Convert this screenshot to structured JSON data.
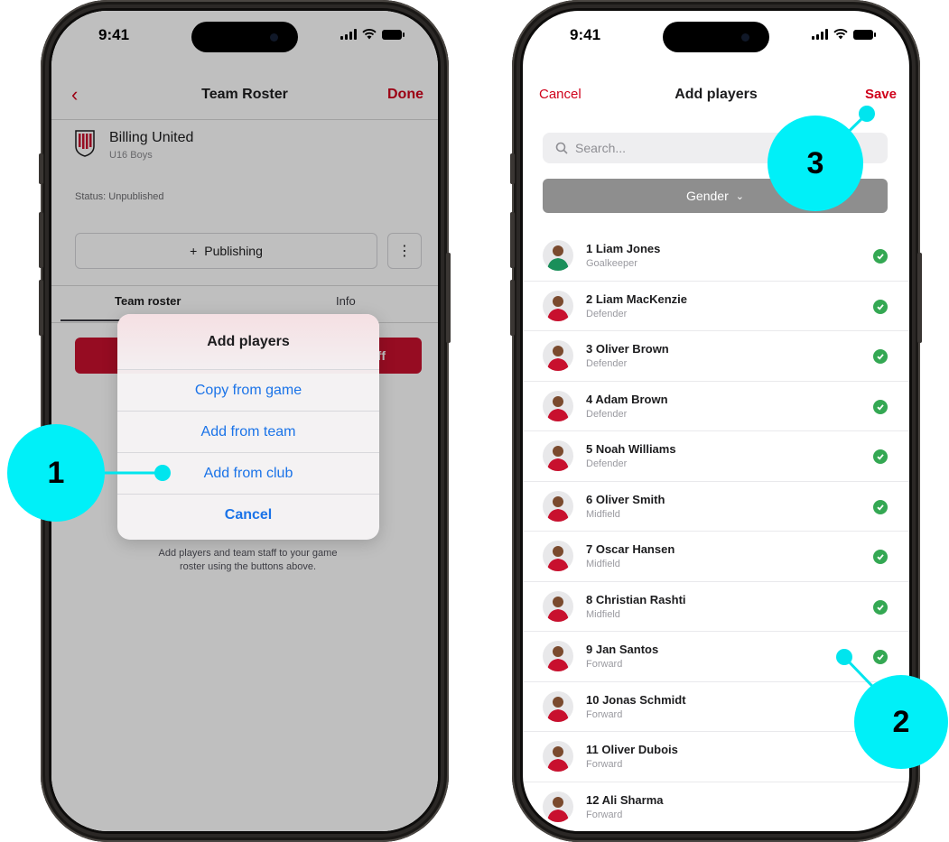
{
  "left_screen": {
    "time": "9:41",
    "nav": {
      "title": "Team Roster",
      "done": "Done"
    },
    "team": {
      "name": "Billing United",
      "subtitle": "U16 Boys"
    },
    "status": "Status: Unpublished",
    "publish_button": "Publishing",
    "tabs": [
      "Team roster",
      "Info"
    ],
    "red_button_fragment": "ff",
    "action_sheet": {
      "title": "Add players",
      "options": [
        "Copy from game",
        "Add from team",
        "Add from club"
      ],
      "cancel": "Cancel"
    },
    "helper_text": "Add players and team staff to your game roster using the buttons above."
  },
  "right_screen": {
    "time": "9:41",
    "nav": {
      "cancel": "Cancel",
      "title": "Add players",
      "save": "Save"
    },
    "search_placeholder": "Search...",
    "filter": "Gender",
    "players": [
      {
        "name": "1 Liam Jones",
        "position": "Goalkeeper",
        "checked": true
      },
      {
        "name": "2 Liam MacKenzie",
        "position": "Defender",
        "checked": true
      },
      {
        "name": "3 Oliver Brown",
        "position": "Defender",
        "checked": true
      },
      {
        "name": "4 Adam Brown",
        "position": "Defender",
        "checked": true
      },
      {
        "name": "5 Noah Williams",
        "position": "Defender",
        "checked": true
      },
      {
        "name": "6 Oliver Smith",
        "position": "Midfield",
        "checked": true
      },
      {
        "name": "7 Oscar Hansen",
        "position": "Midfield",
        "checked": true
      },
      {
        "name": "8 Christian Rashti",
        "position": "Midfield",
        "checked": true
      },
      {
        "name": "9 Jan Santos",
        "position": "Forward",
        "checked": true
      },
      {
        "name": "10 Jonas Schmidt",
        "position": "Forward",
        "checked": false
      },
      {
        "name": "11 Oliver Dubois",
        "position": "Forward",
        "checked": false
      },
      {
        "name": "12 Ali Sharma",
        "position": "Forward",
        "checked": false
      }
    ]
  },
  "callouts": [
    "1",
    "2",
    "3"
  ],
  "colors": {
    "accent": "#d0021b",
    "link": "#1a73e8",
    "check": "#34a853",
    "callout": "#00f0f8"
  }
}
